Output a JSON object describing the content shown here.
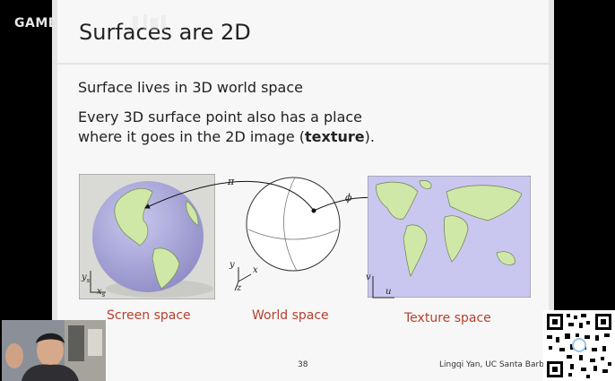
{
  "watermark": {
    "text": "GAME"
  },
  "slide": {
    "title": "Surfaces are 2D",
    "line1": "Surface lives in 3D world space",
    "line2a": "Every 3D surface point also has a place",
    "line2b_pre": "where it goes in the 2D image (",
    "line2b_bold": "texture",
    "line2b_post": ").",
    "captions": {
      "screen": "Screen space",
      "world": "World space",
      "texture": "Texture space"
    },
    "labels": {
      "pi": "π",
      "phi": "ϕ",
      "ys": "y",
      "ys_sub": "s",
      "xs": "x",
      "xs_sub": "s",
      "axis_x": "x",
      "axis_y": "y",
      "axis_z": "z",
      "u": "u",
      "v": "v"
    },
    "page_number": "38",
    "credit": "Lingqi Yan, UC Santa Barbar"
  },
  "colors": {
    "caption": "#b5402e",
    "slide_bg": "#f7f7f7",
    "map_ocean": "#c9c7ef",
    "land": "#cfe8a8"
  }
}
